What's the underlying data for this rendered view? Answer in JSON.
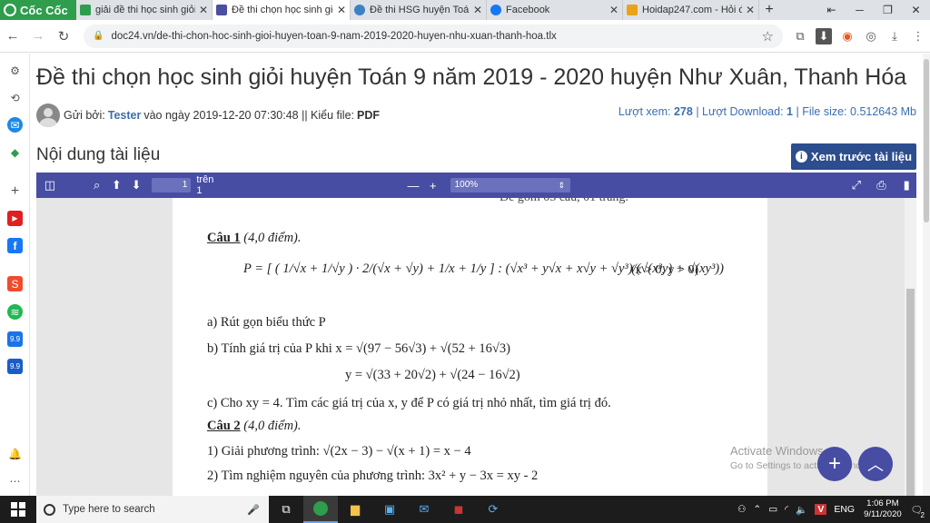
{
  "browser": {
    "brand": "Cốc Cốc",
    "tabs": [
      {
        "label": "giải đề thi học sinh giỏi",
        "color": "#2e9d4c",
        "active": false
      },
      {
        "label": "Đề thi chọn học sinh giỏi",
        "color": "#4a4fa0",
        "active": true
      },
      {
        "label": "Đề thi HSG huyện Toán",
        "color": "#3b82c4",
        "active": false
      },
      {
        "label": "Facebook",
        "color": "#1877f2",
        "active": false
      },
      {
        "label": "Hoidap247.com - Hỏi đ",
        "color": "#e8a317",
        "active": false
      }
    ],
    "new_tab": "+",
    "window_controls": [
      "⇤",
      "─",
      "❐",
      "✕"
    ],
    "url": "doc24.vn/de-thi-chon-hoc-sinh-gioi-huyen-toan-9-nam-2019-2020-huyen-nhu-xuan-thanh-hoa.tlx"
  },
  "sidebar": {
    "icons": [
      "settings-icon",
      "history-icon",
      "messenger-icon",
      "games-icon",
      "add-icon",
      "youtube-icon",
      "facebook-icon",
      "shopee-icon",
      "spotify-icon",
      "tiki-icon",
      "sale-icon",
      "notification-icon",
      "more-icon"
    ]
  },
  "page": {
    "title": "Đề thi chọn học sinh giỏi huyện Toán 9 năm 2019 - 2020 huyện Như Xuân, Thanh Hóa",
    "author_prefix": "Gửi bởi:",
    "author": "Tester",
    "date_text": "vào ngày 2019-12-20 07:30:48 || Kiểu file:",
    "file_type": "PDF",
    "views_label": "Lượt xem:",
    "views": "278",
    "downloads_label": "| Lượt Download:",
    "downloads": "1",
    "size_label": "| File size:",
    "size": "0.512643 Mb",
    "section_heading": "Nội dung tài liệu",
    "preview_button": "Xem trước tài liệu"
  },
  "pdf_toolbar": {
    "page_current": "1",
    "page_total": "trên 1",
    "zoom": "100%"
  },
  "pdf_content": {
    "cut_top": "Đề gồm 05 câu, 01 trang.",
    "q1_title": "Câu 1",
    "q1_points": "(4,0 điểm).",
    "q1_formula": "P = [ ( 1/√x + 1/√y ) · 2/(√x + √y) + 1/x + 1/y ] : (√x³ + y√x + x√y + √y³)/(√(x³y) + √(xy³))",
    "q1_cond": "(x > 0, y > 0)",
    "q1_a": "a) Rút gọn biểu thức P",
    "q1_b": "b) Tính giá trị của P khi  x = √(97 − 56√3) + √(52 + 16√3)",
    "q1_b2": "y = √(33 + 20√2) + √(24 − 16√2)",
    "q1_c": "c) Cho xy = 4. Tìm các giá trị của x, y để P có giá trị nhỏ nhất, tìm giá trị đó.",
    "q2_title": "Câu 2",
    "q2_points": "(4,0 điểm).",
    "q2_1": "1) Giải phương trình: √(2x − 3) − √(x + 1) = x − 4",
    "q2_2": "2) Tìm nghiệm nguyên của phương trình: 3x² + y − 3x = xy - 2"
  },
  "watermark": {
    "line1": "Activate Windows",
    "line2": "Go to Settings to activate Windows."
  },
  "taskbar": {
    "search_placeholder": "Type here to search",
    "lang": "ENG",
    "time": "1:06 PM",
    "date": "9/11/2020",
    "notif_count": "2"
  }
}
